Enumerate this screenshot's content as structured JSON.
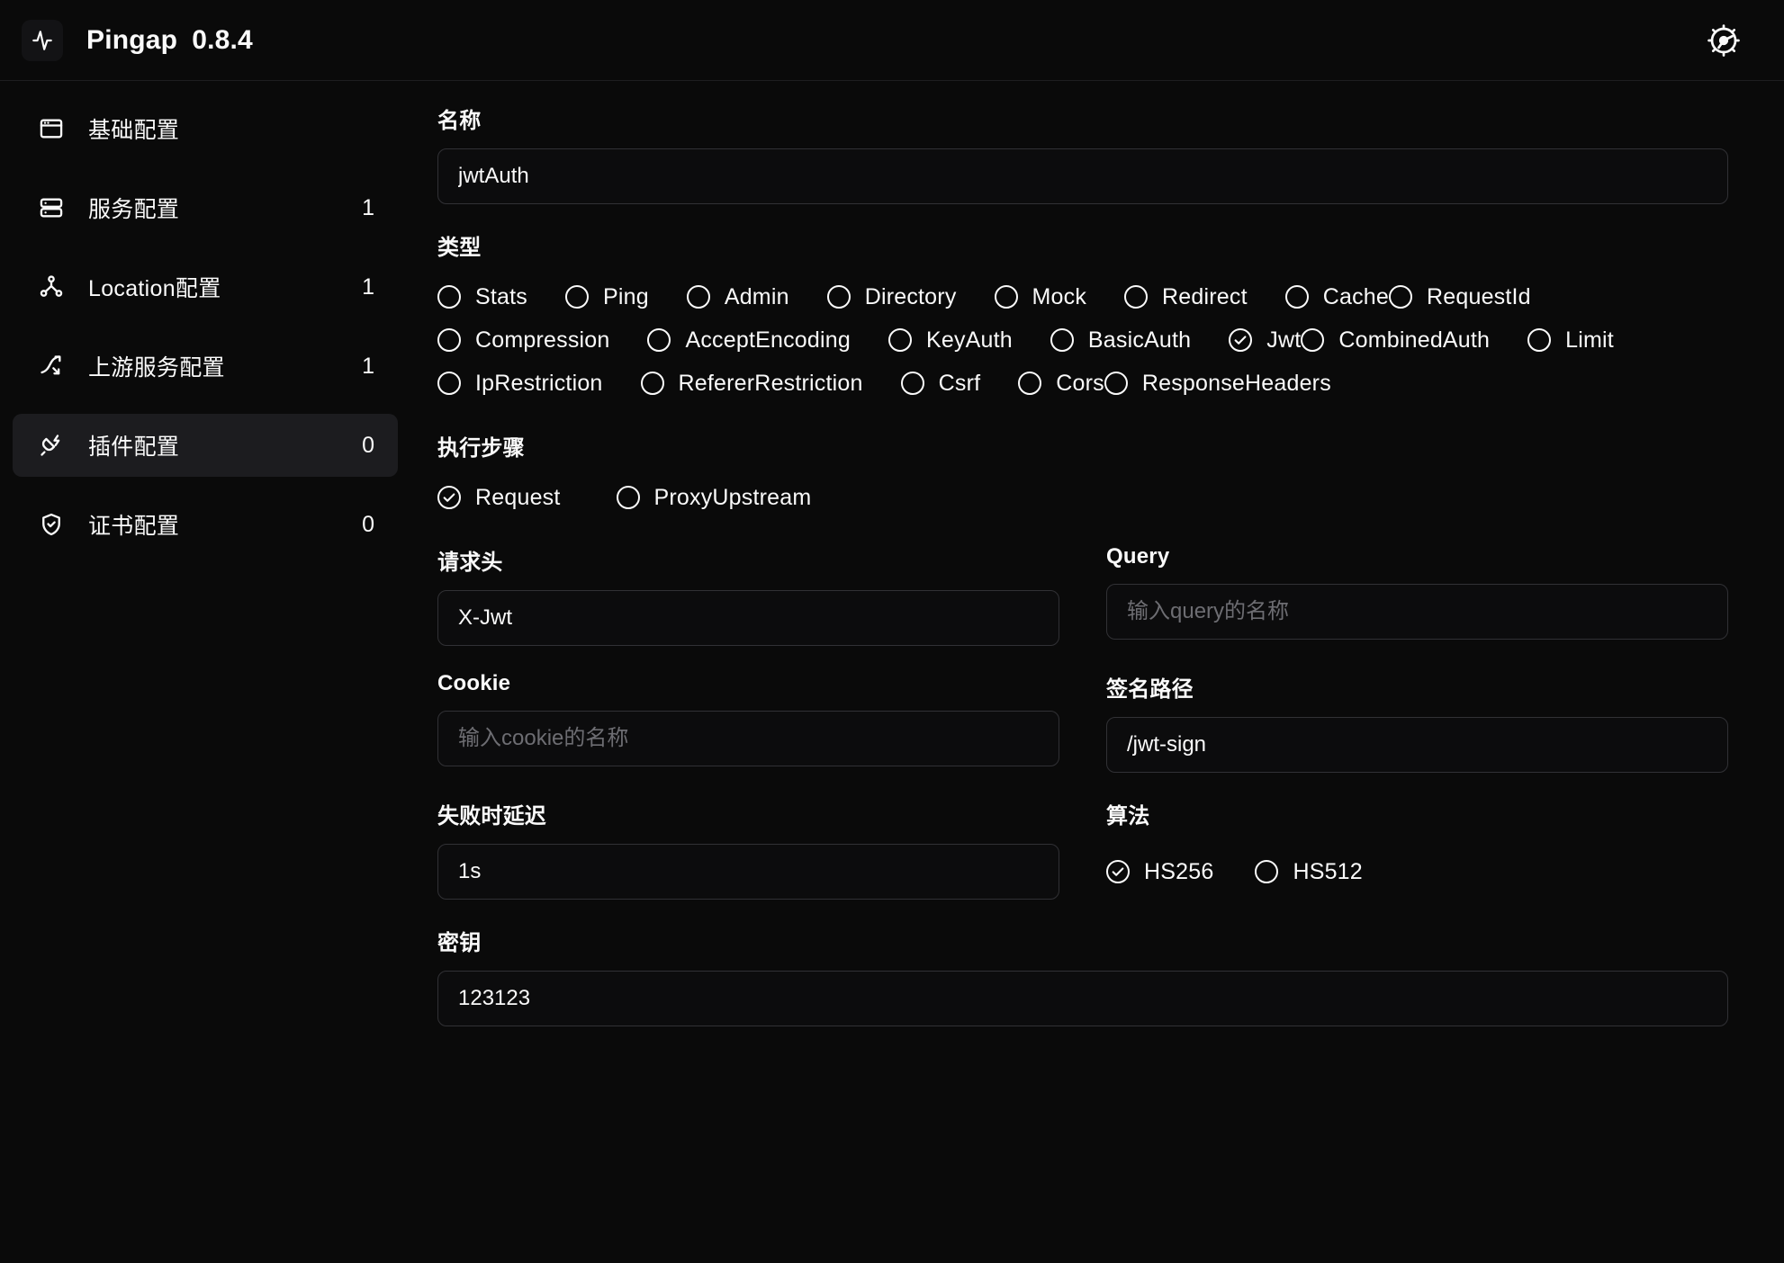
{
  "header": {
    "brand_name": "Pingap",
    "version": "0.8.4",
    "logo_icon": "activity-pulse-icon",
    "settings_icon": "gear-icon"
  },
  "sidebar": {
    "items": [
      {
        "label": "基础配置",
        "count": "",
        "icon": "app-window-icon",
        "active": false
      },
      {
        "label": "服务配置",
        "count": "1",
        "icon": "server-icon",
        "active": false
      },
      {
        "label": "Location配置",
        "count": "1",
        "icon": "waypoints-icon",
        "active": false
      },
      {
        "label": "上游服务配置",
        "count": "1",
        "icon": "shuffle-icon",
        "active": false
      },
      {
        "label": "插件配置",
        "count": "0",
        "icon": "plug-zap-icon",
        "active": true
      },
      {
        "label": "证书配置",
        "count": "0",
        "icon": "shield-check-icon",
        "active": false
      }
    ]
  },
  "form": {
    "name": {
      "label": "名称",
      "value": "jwtAuth",
      "placeholder": ""
    },
    "type": {
      "label": "类型",
      "options": [
        {
          "label": "Stats",
          "checked": false
        },
        {
          "label": "Ping",
          "checked": false
        },
        {
          "label": "Admin",
          "checked": false
        },
        {
          "label": "Directory",
          "checked": false
        },
        {
          "label": "Mock",
          "checked": false
        },
        {
          "label": "Redirect",
          "checked": false
        },
        {
          "label": "Cache",
          "checked": false
        },
        {
          "label": "RequestId",
          "checked": false
        },
        {
          "label": "Compression",
          "checked": false
        },
        {
          "label": "AcceptEncoding",
          "checked": false
        },
        {
          "label": "KeyAuth",
          "checked": false
        },
        {
          "label": "BasicAuth",
          "checked": false
        },
        {
          "label": "Jwt",
          "checked": true
        },
        {
          "label": "CombinedAuth",
          "checked": false
        },
        {
          "label": "Limit",
          "checked": false
        },
        {
          "label": "IpRestriction",
          "checked": false
        },
        {
          "label": "RefererRestriction",
          "checked": false
        },
        {
          "label": "Csrf",
          "checked": false
        },
        {
          "label": "Cors",
          "checked": false
        },
        {
          "label": "ResponseHeaders",
          "checked": false
        }
      ]
    },
    "step": {
      "label": "执行步骤",
      "options": [
        {
          "label": "Request",
          "checked": true
        },
        {
          "label": "ProxyUpstream",
          "checked": false
        }
      ]
    },
    "header_field": {
      "label": "请求头",
      "value": "X-Jwt",
      "placeholder": ""
    },
    "query_field": {
      "label": "Query",
      "value": "",
      "placeholder": "输入query的名称"
    },
    "cookie_field": {
      "label": "Cookie",
      "value": "",
      "placeholder": "输入cookie的名称"
    },
    "sign_path_field": {
      "label": "签名路径",
      "value": "/jwt-sign",
      "placeholder": ""
    },
    "delay_field": {
      "label": "失败时延迟",
      "value": "1s",
      "placeholder": ""
    },
    "algorithm": {
      "label": "算法",
      "options": [
        {
          "label": "HS256",
          "checked": true
        },
        {
          "label": "HS512",
          "checked": false
        }
      ]
    },
    "secret_field": {
      "label": "密钥",
      "value": "123123",
      "placeholder": ""
    }
  },
  "colors": {
    "background": "#0a0a0a",
    "panel": "#0c0c0d",
    "active_item": "#1c1c1f",
    "border": "#313135",
    "text": "#fafafa",
    "muted": "#6d6d72"
  }
}
